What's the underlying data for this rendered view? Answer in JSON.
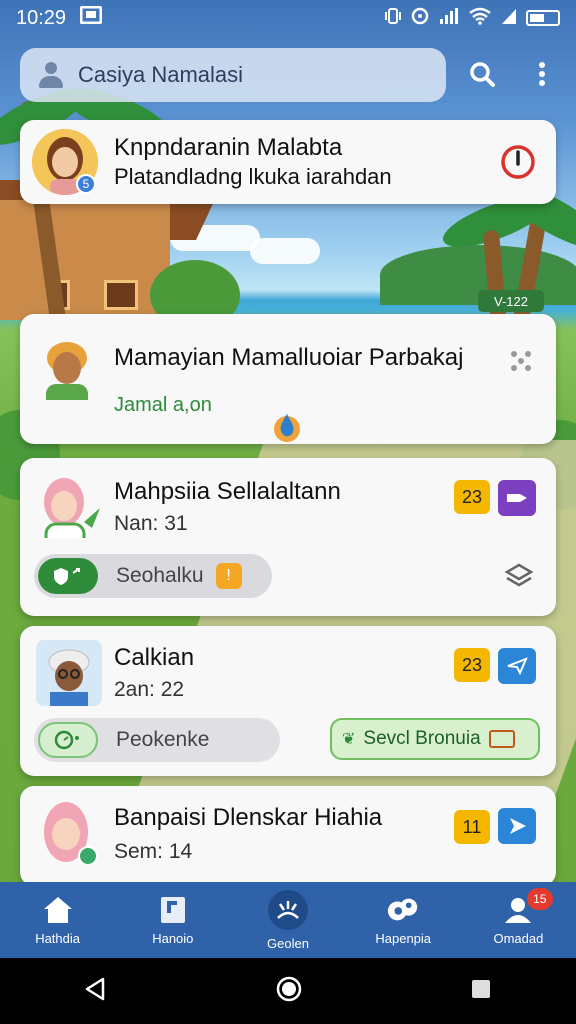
{
  "status_bar": {
    "time": "10:29",
    "icons": [
      "sim-icon",
      "vibrate-icon",
      "signal-icon",
      "wifi-icon",
      "battery-icon"
    ]
  },
  "search": {
    "placeholder": "Casiya Namalasi"
  },
  "scene": {
    "sign_text": "V-122"
  },
  "cards": [
    {
      "title": "Knpndaranin Malabta",
      "subtitle": "Platandladng lkuka iarahdan",
      "avatar": "woman-avatar",
      "avatar_badge": "5"
    },
    {
      "title": "Mamayian  Mamalluoiar Parbakaj",
      "subtitle": "Jamal a,on",
      "avatar": "man-avatar"
    },
    {
      "title": "Mahpsiia Sellalaltann",
      "subtitle": "Nan: 31",
      "badge": "23",
      "pill_label": "Seohalku",
      "avatar": "girl-avatar"
    },
    {
      "title": "Calkian",
      "subtitle": "2an: 22",
      "badge": "23",
      "pill_label": "Peokenke",
      "action_label": "Sevcl Bronuia",
      "avatar": "elder-avatar"
    },
    {
      "title": "Banpaisi Dlenskar Hiahia",
      "subtitle": "Sem: 14",
      "badge": "11",
      "avatar": "woman-pink-avatar"
    }
  ],
  "bottom_nav": [
    {
      "label": "Hathdia",
      "icon": "home-icon"
    },
    {
      "label": "Hanoio",
      "icon": "bookmark-icon"
    },
    {
      "label": "Geolen",
      "icon": "splash-icon"
    },
    {
      "label": "Hapenpia",
      "icon": "puzzle-icon"
    },
    {
      "label": "Omadad",
      "icon": "profile-icon",
      "notification": "15"
    }
  ],
  "colors": {
    "accent": "#2f62a8",
    "green": "#2e8b3a",
    "yellow": "#f5b800",
    "purple": "#7b3fbf",
    "blue": "#2b86d8"
  }
}
